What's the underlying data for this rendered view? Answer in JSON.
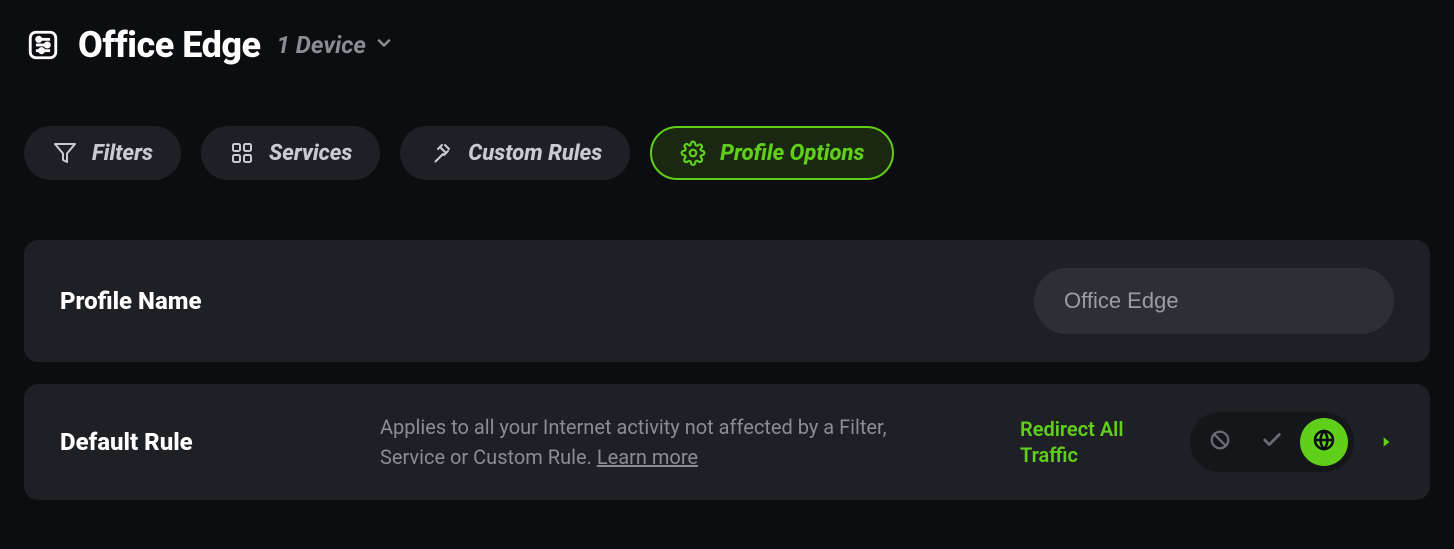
{
  "header": {
    "title": "Office Edge",
    "device_count": "1 Device"
  },
  "tabs": [
    {
      "label": "Filters",
      "icon": "funnel"
    },
    {
      "label": "Services",
      "icon": "grid"
    },
    {
      "label": "Custom Rules",
      "icon": "gavel"
    },
    {
      "label": "Profile Options",
      "icon": "gear"
    }
  ],
  "active_tab": 3,
  "profile_name": {
    "label": "Profile Name",
    "value": "Office Edge"
  },
  "default_rule": {
    "label": "Default Rule",
    "description": "Applies to all your Internet activity not affected by a Filter, Service or Custom Rule. ",
    "learn_more": "Learn more",
    "status": "Redirect All Traffic"
  }
}
